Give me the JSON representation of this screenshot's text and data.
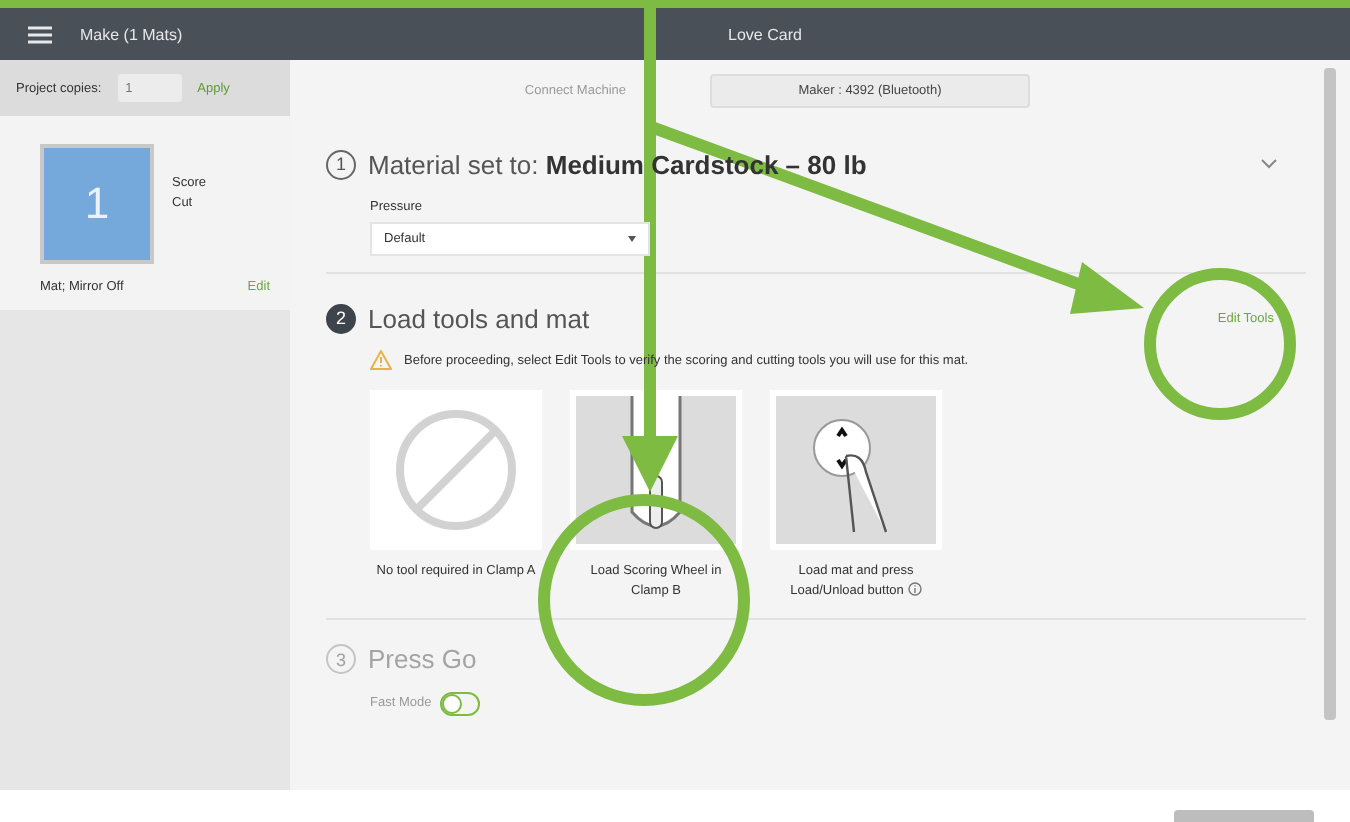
{
  "header": {
    "menu_title": "Make (1 Mats)",
    "project_title": "Love Card"
  },
  "sidebar": {
    "copies_label": "Project copies:",
    "copies_value": "1",
    "apply": "Apply",
    "mats": [
      {
        "number": "1",
        "operations": [
          "Score",
          "Cut"
        ],
        "note": "Mat; Mirror Off",
        "edit": "Edit",
        "selected": true
      }
    ]
  },
  "connect": {
    "label": "Connect Machine",
    "machine": "Maker : 4392 (Bluetooth)"
  },
  "steps": [
    {
      "kind": "material",
      "number": "1",
      "title": "Material set to: **Medium Cardstock – 80 lb**",
      "active": false,
      "disabled": false,
      "pressure_label": "Pressure",
      "pressure_value": "Default"
    },
    {
      "kind": "tools",
      "number": "2",
      "title": "Load tools and mat",
      "active": true,
      "disabled": false,
      "action": "Edit Tools",
      "warning": "Before proceeding, select Edit Tools to verify the scoring and cutting tools you will use for this mat.",
      "cards": [
        {
          "kind": "none",
          "caption": "No tool required in Clamp A"
        },
        {
          "kind": "scoring-wheel",
          "caption": "Load Scoring Wheel in Clamp B"
        },
        {
          "kind": "press",
          "caption": "Load mat and press Load/Unload button",
          "info": true
        }
      ]
    },
    {
      "kind": "go",
      "number": "3",
      "title": "Press Go",
      "active": false,
      "disabled": true,
      "fast_mode_label": "Fast Mode",
      "fast_mode_on": false
    }
  ]
}
